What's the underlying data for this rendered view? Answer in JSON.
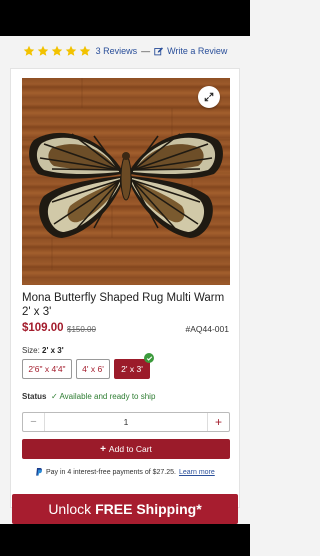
{
  "reviews": {
    "rating_stars": 5,
    "star_color": "#f2c200",
    "count_label": "3 Reviews",
    "separator": "—",
    "write_label": "Write a Review"
  },
  "product": {
    "title": "Mona Butterfly Shaped Rug Multi Warm 2' x 3'",
    "price": "$109.00",
    "old_price": "$150.00",
    "sku": "#AQ44-001",
    "size_label": "Size:",
    "size_value": "2' x 3'",
    "sizes": [
      "2'6\" x 4'4\"",
      "4' x 6'",
      "2' x 3'"
    ],
    "selected_size_index": 2,
    "status_label": "Status",
    "status_value": "✓ Available and ready to ship",
    "quantity": "1",
    "qty_minus": "−",
    "qty_plus": "+",
    "add_to_cart": "Add to Cart",
    "add_icon": "+",
    "paypal_text": "Pay in 4 interest-free payments of $27.25.",
    "paypal_link": "Learn more"
  },
  "promo": {
    "prefix": "Unlock",
    "emphasis": "FREE Shipping*"
  },
  "colors": {
    "brand": "#9b1b2a",
    "link": "#2a4f9a",
    "available": "#2e7d32"
  },
  "icons": [
    "star-icon",
    "pencil-icon",
    "expand-icon",
    "check-icon",
    "plus-icon",
    "paypal-icon"
  ]
}
